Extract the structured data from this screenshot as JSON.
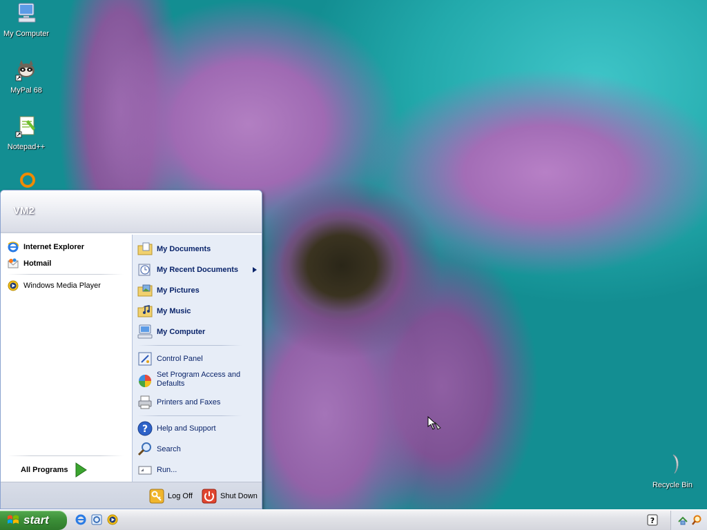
{
  "desktop": {
    "icons": [
      {
        "label": "My Computer"
      },
      {
        "label": "MyPal 68"
      },
      {
        "label": "Notepad++"
      },
      {
        "label": "Recycle Bin"
      }
    ]
  },
  "start_menu": {
    "user_name": "VM2",
    "pinned": [
      {
        "label": "Internet Explorer"
      },
      {
        "label": "Hotmail"
      }
    ],
    "recent": [
      {
        "label": "Windows Media Player"
      }
    ],
    "all_programs_label": "All Programs",
    "places": [
      {
        "label": "My Documents"
      },
      {
        "label": "My Recent Documents"
      },
      {
        "label": "My Pictures"
      },
      {
        "label": "My Music"
      },
      {
        "label": "My Computer"
      }
    ],
    "settings": [
      {
        "label": "Control Panel"
      },
      {
        "label": "Set Program Access and Defaults"
      },
      {
        "label": "Printers and Faxes"
      }
    ],
    "tools": [
      {
        "label": "Help and Support"
      },
      {
        "label": "Search"
      },
      {
        "label": "Run..."
      }
    ],
    "log_off_label": "Log Off",
    "shut_down_label": "Shut Down"
  },
  "taskbar": {
    "start_label": "start"
  },
  "colors": {
    "start_green": "#3c8f38",
    "menu_blue_text": "#0a246a",
    "right_pane": "#e7edf7"
  }
}
